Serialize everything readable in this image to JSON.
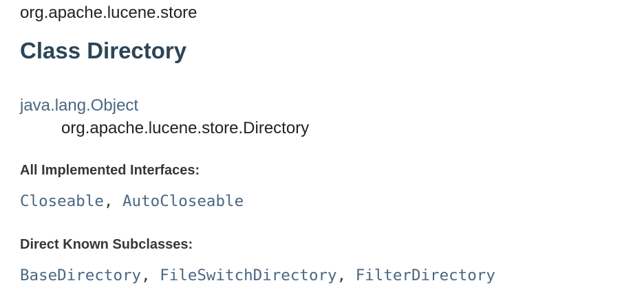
{
  "package_name": "org.apache.lucene.store",
  "class_title": "Class Directory",
  "inheritance": {
    "root": "java.lang.Object",
    "child": "org.apache.lucene.store.Directory"
  },
  "implemented_interfaces": {
    "label": "All Implemented Interfaces:",
    "items": [
      "Closeable",
      "AutoCloseable"
    ],
    "separator": ", "
  },
  "known_subclasses": {
    "label": "Direct Known Subclasses:",
    "items": [
      "BaseDirectory",
      "FileSwitchDirectory",
      "FilterDirectory"
    ],
    "separator": ", "
  },
  "colors": {
    "link": "#4a6782",
    "title": "#2c4557",
    "text": "#353833"
  }
}
